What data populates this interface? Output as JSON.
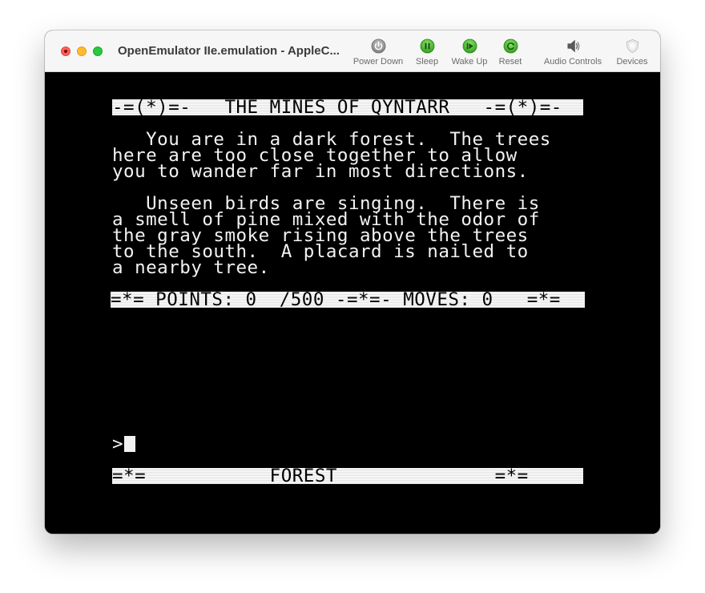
{
  "window": {
    "title": "OpenEmulator IIe.emulation - AppleC..."
  },
  "toolbar": [
    {
      "id": "power-down",
      "label": "Power Down",
      "icon": "power-icon",
      "color": "#8c8c8c"
    },
    {
      "id": "sleep",
      "label": "Sleep",
      "icon": "pause-icon",
      "color": "#3fbf2a"
    },
    {
      "id": "wake-up",
      "label": "Wake Up",
      "icon": "play-icon",
      "color": "#3fbf2a"
    },
    {
      "id": "reset",
      "label": "Reset",
      "icon": "reset-icon",
      "color": "#3fbf2a"
    },
    {
      "id": "audio-controls",
      "label": "Audio Controls",
      "icon": "speaker-icon",
      "color": "#555555"
    },
    {
      "id": "devices",
      "label": "Devices",
      "icon": "shield-icon",
      "color": "#c8c8c8"
    }
  ],
  "screen": {
    "header": "-=(*)=-   THE MINES OF QYNTARR   -=(*)=-",
    "paragraph1": [
      "   You are in a dark forest.  The trees",
      "here are too close together to allow",
      "you to wander far in most directions."
    ],
    "paragraph2": [
      "   Unseen birds are singing.  There is",
      "a smell of pine mixed with the odor of",
      "the gray smoke rising above the trees",
      "to the south.  A placard is nailed to",
      "a nearby tree."
    ],
    "status": "=*= POINTS: 0  /500 -=*=- MOVES: 0   =*=",
    "prompt": ">",
    "footer": "=*=           FOREST              =*="
  }
}
